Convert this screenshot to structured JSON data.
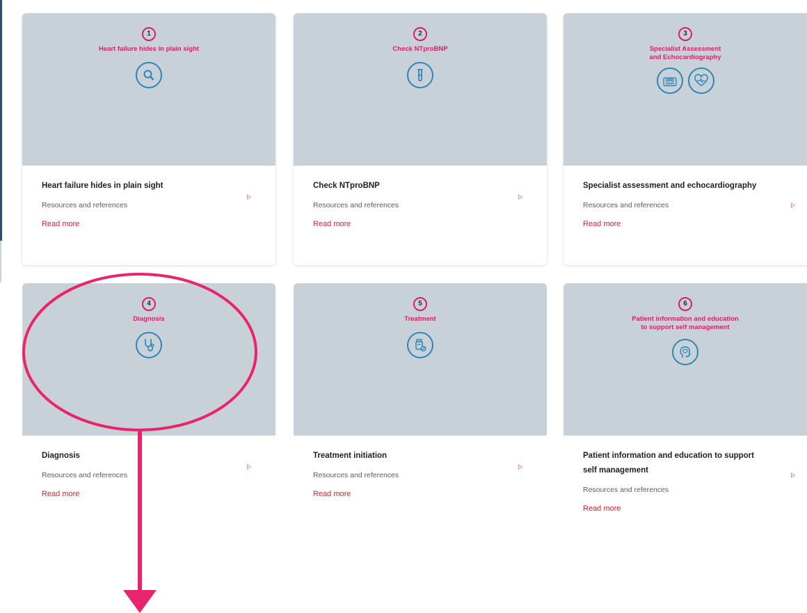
{
  "colors": {
    "accent": "#d41f6a",
    "icon": "#2a86b8",
    "link": "#e11d2e",
    "card_header_bg": "#c9d1d8",
    "annotation": "#e8246e"
  },
  "cards": [
    {
      "number": "1",
      "header_lines": [
        "Heart failure hides in plain sight"
      ],
      "icons": [
        "magnifier-icon"
      ],
      "title": "Heart failure hides in plain sight",
      "subtitle": "Resources and references",
      "link": "Read more"
    },
    {
      "number": "2",
      "header_lines": [
        "Check NTproBNP"
      ],
      "icons": [
        "test-tube-icon"
      ],
      "title": "Check NTproBNP",
      "subtitle": "Resources and references",
      "link": "Read more"
    },
    {
      "number": "3",
      "header_lines": [
        "Specialist Assessment",
        "and Echocardiography"
      ],
      "icons": [
        "specialist-team-icon",
        "heart-pulse-icon"
      ],
      "title": "Specialist assessment and echocardiography",
      "subtitle": "Resources and references",
      "link": "Read more"
    },
    {
      "number": "4",
      "header_lines": [
        "Diagnosis"
      ],
      "icons": [
        "stethoscope-icon"
      ],
      "title": "Diagnosis",
      "subtitle": "Resources and references",
      "link": "Read more"
    },
    {
      "number": "5",
      "header_lines": [
        "Treatment"
      ],
      "icons": [
        "medication-icon"
      ],
      "title": "Treatment initiation",
      "subtitle": "Resources and references",
      "link": "Read more"
    },
    {
      "number": "6",
      "header_lines": [
        "Patient information and education",
        "to support self management"
      ],
      "icons": [
        "head-brain-icon"
      ],
      "title": "Patient information and education to support self management",
      "subtitle": "Resources and references",
      "link": "Read more"
    }
  ]
}
